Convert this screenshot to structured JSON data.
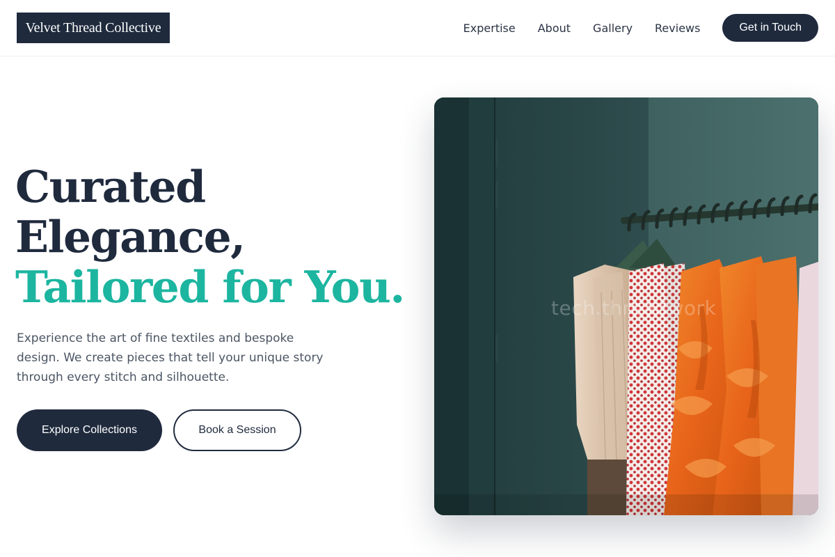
{
  "header": {
    "logo": "Velvet Thread Collective",
    "nav": [
      "Expertise",
      "About",
      "Gallery",
      "Reviews"
    ],
    "cta": "Get in Touch"
  },
  "hero": {
    "title_lines": [
      "Curated",
      "Elegance,"
    ],
    "title_accent": "Tailored for You.",
    "description": "Experience the art of fine textiles and bespoke design. We create pieces that tell your unique story through every stitch and silhouette.",
    "primary_button": "Explore Collections",
    "secondary_button": "Book a Session",
    "image": {
      "subject": "clothing rack with hanging garments",
      "watermark": "tech.threadwork"
    }
  },
  "colors": {
    "navy": "#1f2a3d",
    "accent": "#1cb5a0",
    "text_muted": "#4b5563"
  }
}
